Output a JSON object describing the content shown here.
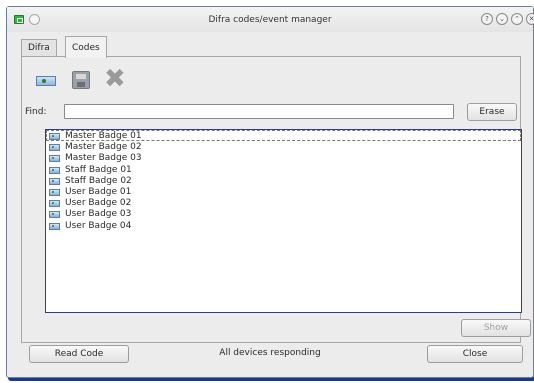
{
  "window": {
    "title": "Difra codes/event manager"
  },
  "titlebar_buttons": [
    "?",
    "⌄",
    "⌃",
    "✕"
  ],
  "tabs": [
    {
      "label": "Difra",
      "active": false
    },
    {
      "label": "Codes",
      "active": true
    }
  ],
  "toolbar": {
    "icons": [
      "add-badge-icon",
      "save-icon",
      "delete-icon"
    ]
  },
  "find": {
    "label": "Find:",
    "value": "",
    "erase_label": "Erase"
  },
  "codes": [
    "Master Badge 01",
    "Master Badge 02",
    "Master Badge 03",
    "Staff Badge 01",
    "Staff Badge 02",
    "User Badge 01",
    "User Badge 02",
    "User Badge 03",
    "User Badge 04"
  ],
  "selected_index": 0,
  "show_label": "Show",
  "footer": {
    "read_code_label": "Read Code",
    "status": "All devices responding",
    "close_label": "Close"
  }
}
